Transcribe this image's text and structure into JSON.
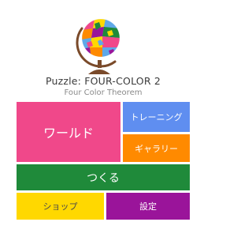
{
  "header": {
    "logo_icon": "colored-globe-icon",
    "title": "Puzzle: FOUR-COLOR 2",
    "subtitle": "Four Color Theorem"
  },
  "menu": {
    "world": {
      "label": "ワールド",
      "color": "#f0488a"
    },
    "training": {
      "label": "トレーニング",
      "color": "#5f8ef0"
    },
    "gallery": {
      "label": "ギャラリー",
      "color": "#ff8a00"
    },
    "create": {
      "label": "つくる",
      "color": "#1f8a3a"
    },
    "shop": {
      "label": "ショップ",
      "color": "#ffd800"
    },
    "settings": {
      "label": "設定",
      "color": "#9a149a"
    }
  }
}
